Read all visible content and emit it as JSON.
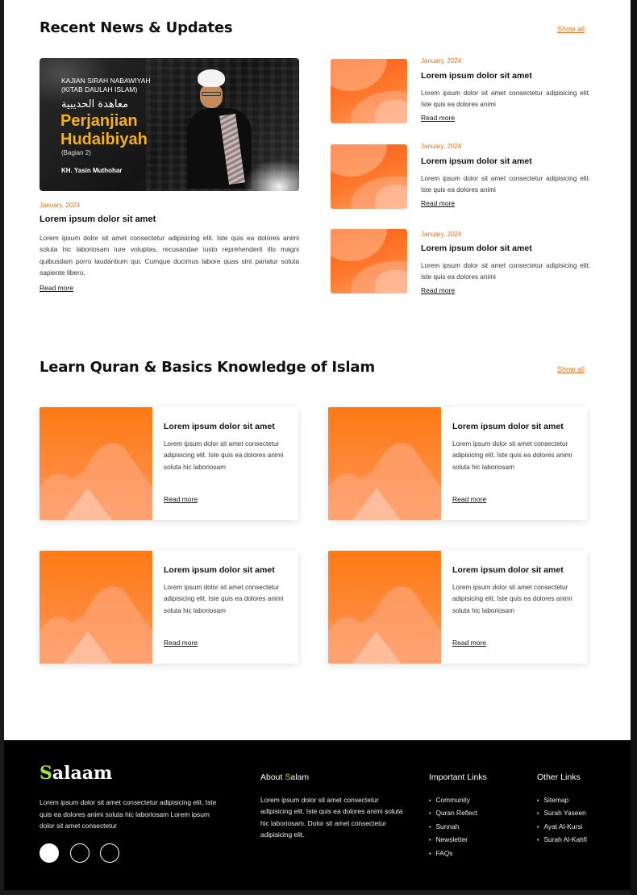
{
  "news": {
    "heading": "Recent News & Updates",
    "show_all": "Show all",
    "featured": {
      "banner": {
        "kajian": "KAJIAN SIRAH NABAWIYAH",
        "kitab": "(KITAB DAULAH ISLAM)",
        "arabic": "معاهدة الحديبية",
        "title_line1": "Perjanjian",
        "title_line2": "Hudaibiyah",
        "bagian": "(Bagian 2)",
        "author": "KH. Yasin Muthohar"
      },
      "date": "January, 2024",
      "title": "Lorem ipsum dolor sit amet",
      "desc": "Lorem ipsum dolor sit amet consectetur adipisicing elit. Iste quis ea dolores animi soluta hic laboriosam iure voluptas, recusandae iusto reprehenderit illo magni quibusdam porro laudantium qui. Cumque ducimus labore quas sint pariatur soluta sapiente libero,",
      "read_more": "Read more"
    },
    "items": [
      {
        "date": "January, 2024",
        "title": "Lorem ipsum dolor sit amet",
        "desc": "Lorem ipsum dolor sit amet consectetur adipisicing elit. Iste quis ea dolores animi",
        "read_more": "Read more"
      },
      {
        "date": "January, 2024",
        "title": "Lorem ipsum dolor sit amet",
        "desc": "Lorem ipsum dolor sit amet consectetur adipisicing elit. Iste quis ea dolores animi",
        "read_more": "Read more"
      },
      {
        "date": "January, 2024",
        "title": "Lorem ipsum dolor sit amet",
        "desc": "Lorem ipsum dolor sit amet consectetur adipisicing elit. Iste quis ea dolores animi",
        "read_more": "Read more"
      }
    ]
  },
  "learn": {
    "heading": "Learn Quran & Basics Knowledge of Islam",
    "show_all": "Show all",
    "cards": [
      {
        "title": "Lorem ipsum dolor sit amet",
        "desc": "Lorem ipsum dolor sit amet consectetur adipisicing elit. Iste quis ea dolores animi soluta hic laboriosam",
        "read_more": "Read more"
      },
      {
        "title": "Lorem ipsum dolor sit amet",
        "desc": "Lorem ipsum dolor sit amet consectetur adipisicing elit. Iste quis ea dolores animi soluta hic laboriosam",
        "read_more": "Read more"
      },
      {
        "title": "Lorem ipsum dolor sit amet",
        "desc": "Lorem ipsum dolor sit amet consectetur adipisicing elit. Iste quis ea dolores animi soluta hic laboriosam",
        "read_more": "Read more"
      },
      {
        "title": "Lorem ipsum dolor sit amet",
        "desc": "Lorem ipsum dolor sit amet consectetur adipisicing elit. Iste quis ea dolores animi soluta hic laboriosam",
        "read_more": "Read more"
      }
    ]
  },
  "footer": {
    "logo_first": "S",
    "logo_rest": "alaam",
    "desc": "Lorem ipsum dolor sit amet consectetur adipisicing elit. Iste quis ea dolores animi soluta hic laboriosam Lorem ipsum dolor sit amet consectetur",
    "social_icons": [
      "social-icon-filled",
      "social-icon-outline",
      "social-icon-outline"
    ],
    "about": {
      "heading_prefix": "About ",
      "heading_s": "S",
      "heading_rest": "alam",
      "text": "Lorem ipsum dolor sit amet consectetur adipisicing elit. Iste quis ea dolores animi soluta hic laboriosam. Dolor sit amet consectetur adipisicing elit."
    },
    "important_links": {
      "heading": "Important Links",
      "items": [
        "Community",
        "Quran Reflect",
        "Sunnah",
        "Newsletter",
        "FAQs"
      ]
    },
    "other_links": {
      "heading": "Other Links",
      "items": [
        "Sitemap",
        "Surah Yaseen",
        "Ayat Al-Kursi",
        "Surah Al-Kahfi"
      ]
    },
    "colors": {
      "accent": "#a6e22e",
      "orange": "#e8711f",
      "background": "#000000"
    }
  }
}
